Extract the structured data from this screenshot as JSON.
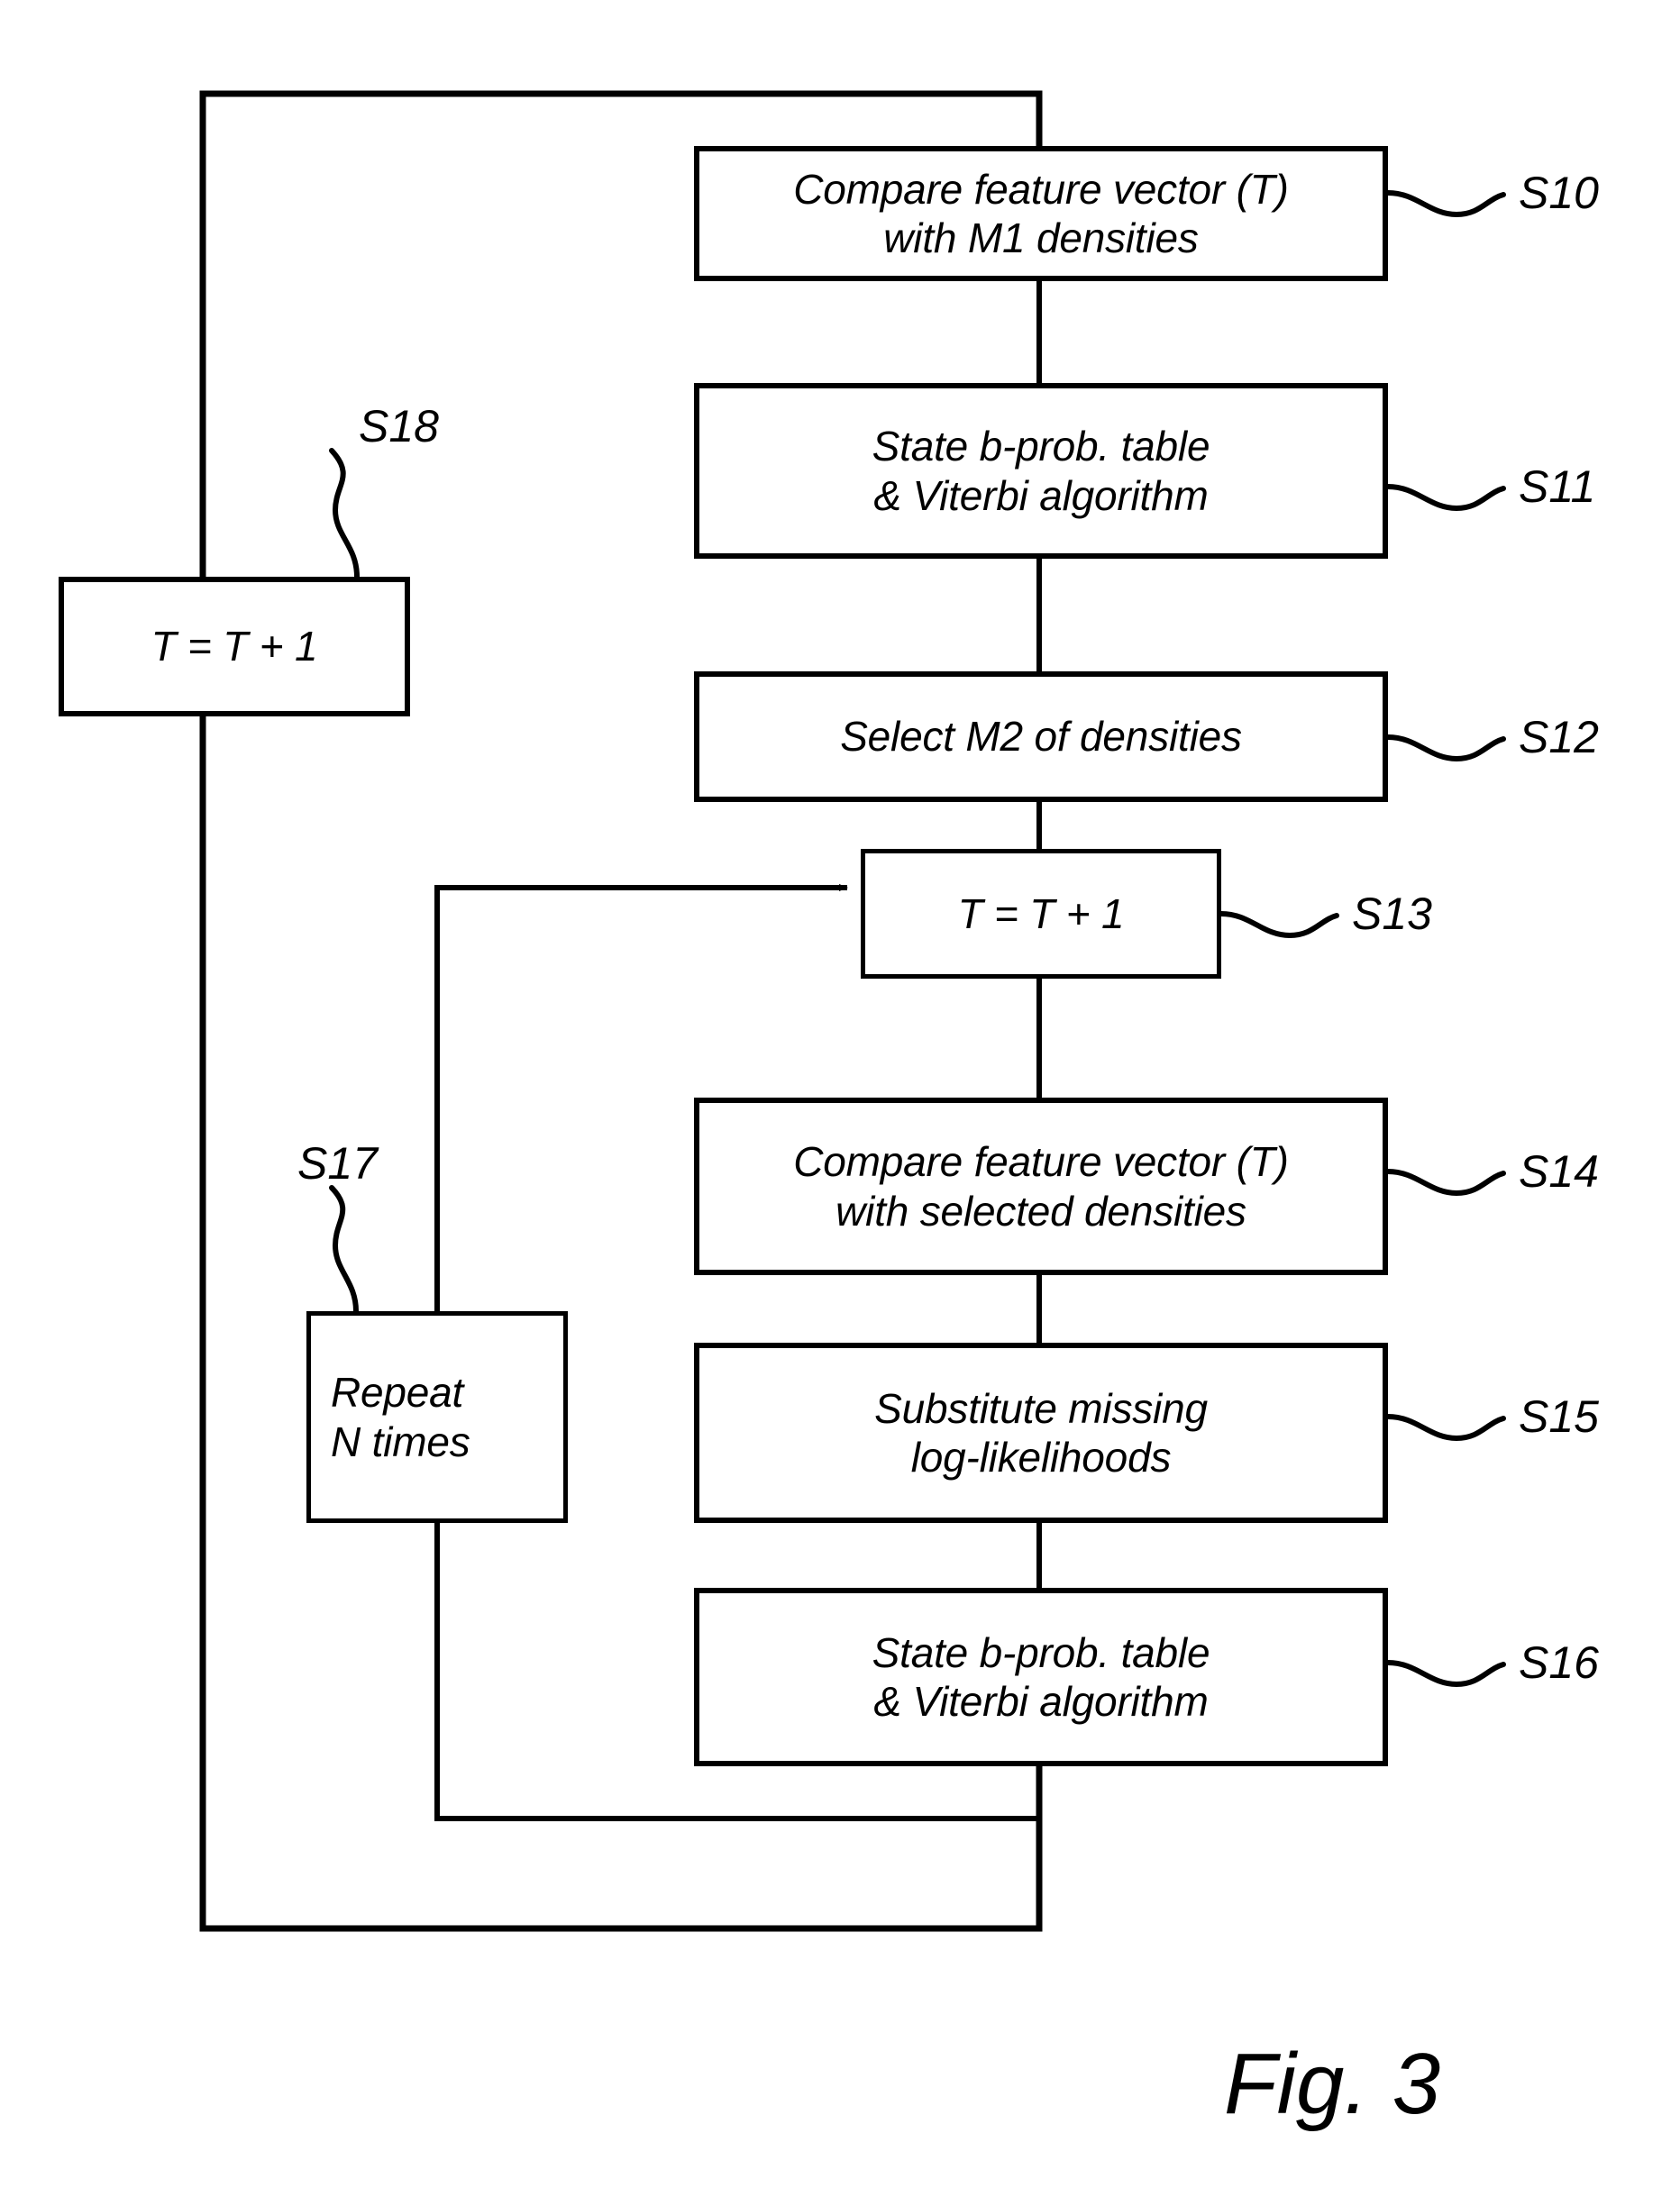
{
  "figure": {
    "caption": "Fig. 3",
    "type": "patent-flowchart"
  },
  "nodes": [
    {
      "id": "S10",
      "ref": "S10",
      "lines": [
        "Compare feature vector (T)",
        "with M1 densities"
      ]
    },
    {
      "id": "S11",
      "ref": "S11",
      "lines": [
        "State b-prob. table",
        "& Viterbi algorithm"
      ]
    },
    {
      "id": "S12",
      "ref": "S12",
      "lines": [
        "Select M2 of densities"
      ]
    },
    {
      "id": "S13",
      "ref": "S13",
      "lines": [
        "T = T + 1"
      ]
    },
    {
      "id": "S14",
      "ref": "S14",
      "lines": [
        "Compare feature vector (T)",
        "with selected densities"
      ]
    },
    {
      "id": "S15",
      "ref": "S15",
      "lines": [
        "Substitute missing",
        "log-likelihoods"
      ]
    },
    {
      "id": "S16",
      "ref": "S16",
      "lines": [
        "State b-prob. table",
        "& Viterbi algorithm"
      ]
    },
    {
      "id": "S17",
      "ref": "S17",
      "lines": [
        "Repeat",
        "N times"
      ]
    },
    {
      "id": "S18",
      "ref": "S18",
      "lines": [
        "T = T + 1"
      ]
    }
  ],
  "text": {
    "s10_line1": "Compare feature vector (T)",
    "s10_line2": "with M1 densities",
    "s11_line1": "State b-prob. table",
    "s11_line2": "& Viterbi algorithm",
    "s12_line1": "Select M2 of densities",
    "s13_line1": "T = T + 1",
    "s14_line1": "Compare feature vector (T)",
    "s14_line2": "with selected densities",
    "s15_line1": "Substitute missing",
    "s15_line2": "log-likelihoods",
    "s16_line1": "State b-prob. table",
    "s16_line2": "& Viterbi algorithm",
    "s17_line1": "Repeat",
    "s17_line2": "N times",
    "s18_line1": "T = T + 1"
  },
  "refs": {
    "s10": "S10",
    "s11": "S11",
    "s12": "S12",
    "s13": "S13",
    "s14": "S14",
    "s15": "S15",
    "s16": "S16",
    "s17": "S17",
    "s18": "S18"
  },
  "colors": {
    "ink": "#000000",
    "paper": "#ffffff"
  }
}
